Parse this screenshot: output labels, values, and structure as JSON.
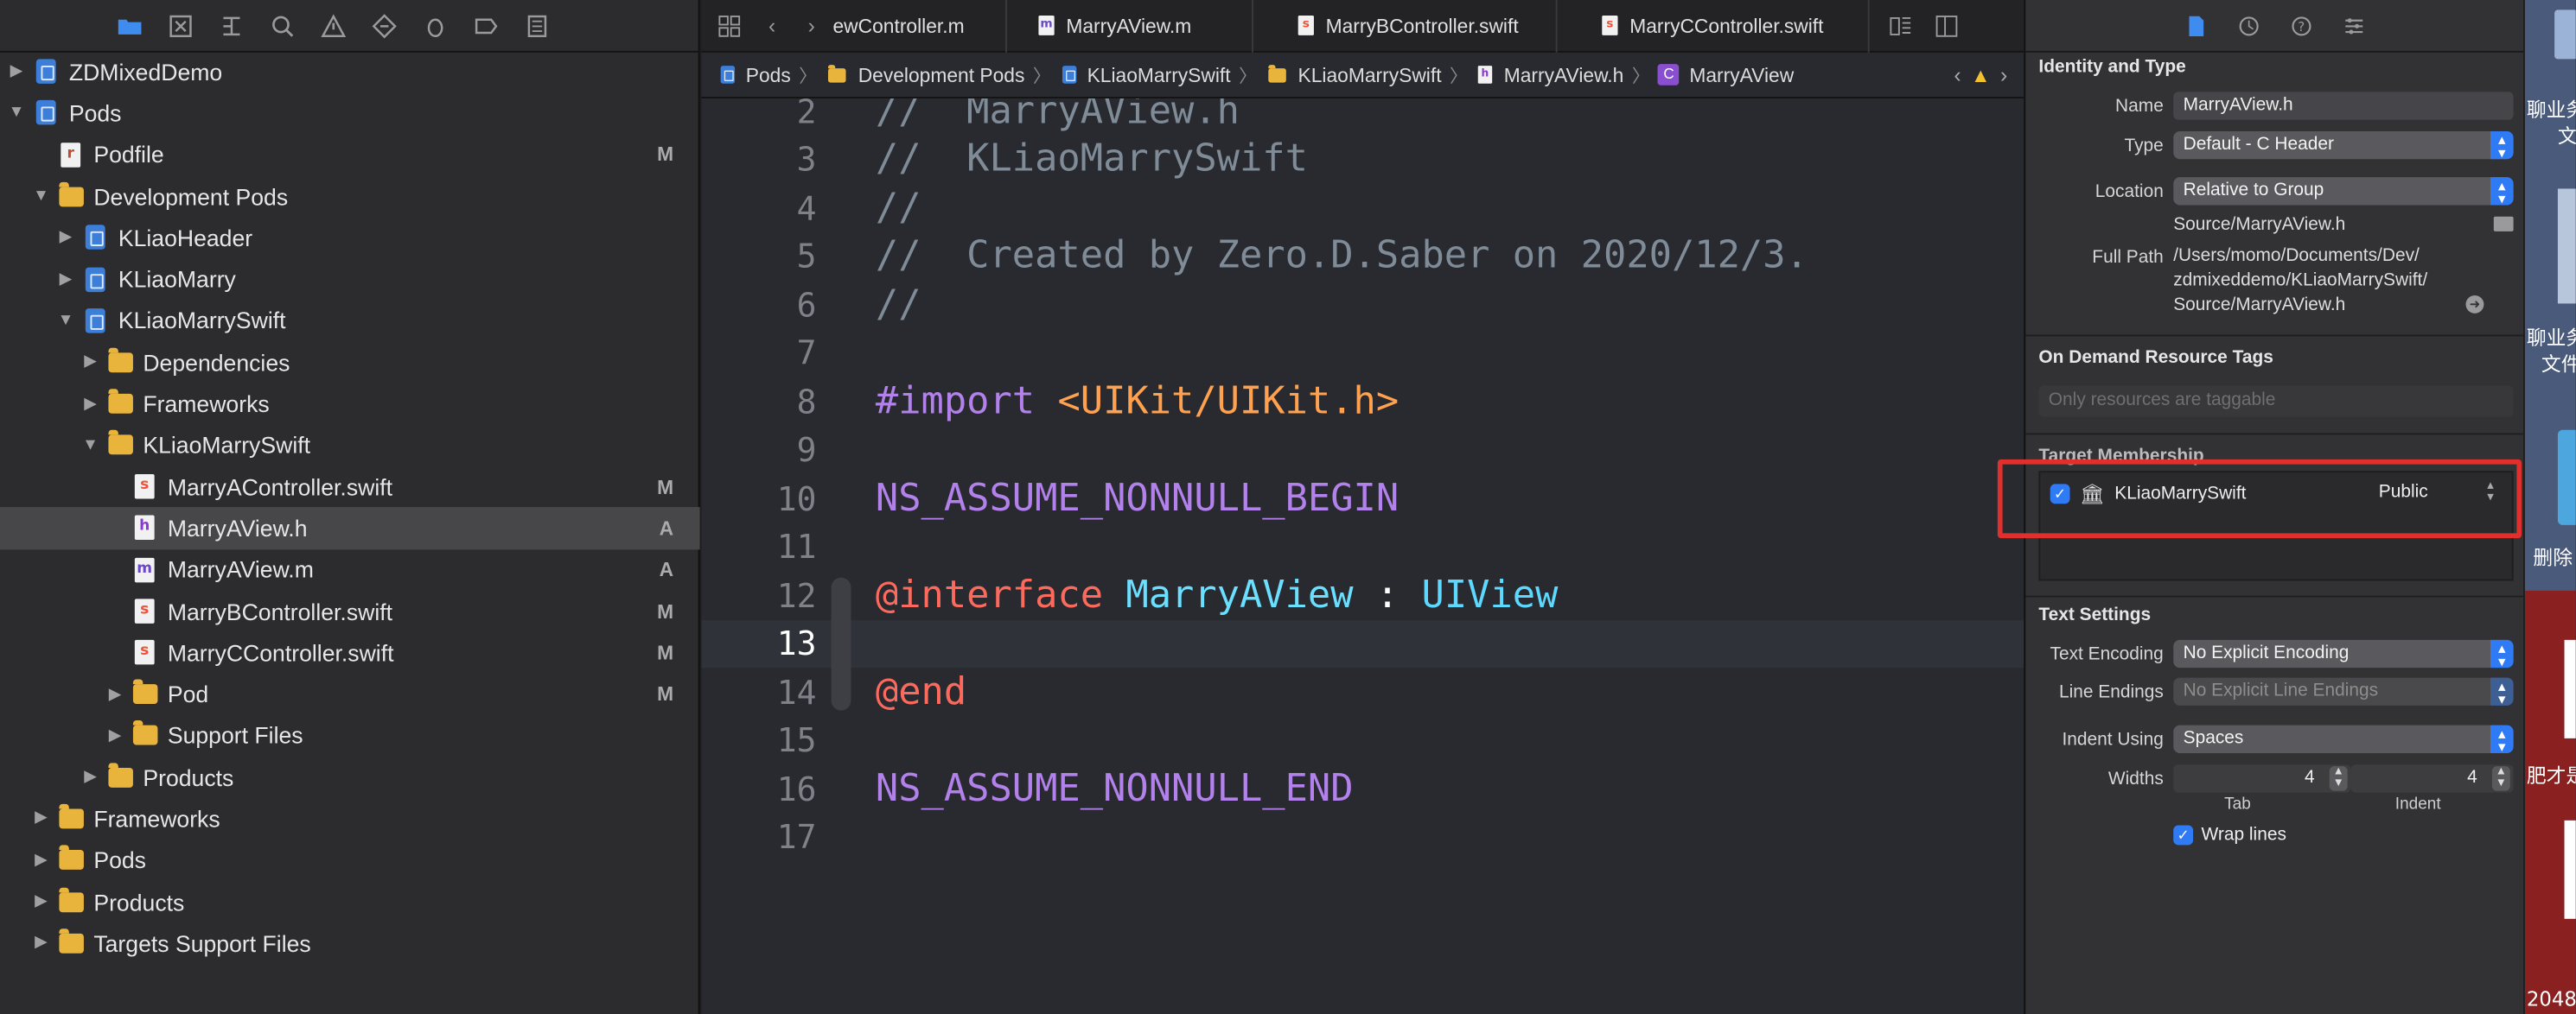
{
  "navigator": {
    "rows": [
      {
        "label": "ZDMixedDemo",
        "icon": "project-icon",
        "indent": 0,
        "tri": "▶",
        "status": ""
      },
      {
        "label": "Pods",
        "icon": "project-icon",
        "indent": 0,
        "tri": "▼",
        "status": ""
      },
      {
        "label": "Podfile",
        "icon": "podfile-icon",
        "indent": 1,
        "tri": "",
        "status": "M"
      },
      {
        "label": "Development Pods",
        "icon": "folder-icon",
        "indent": 1,
        "tri": "▼",
        "status": ""
      },
      {
        "label": "KLiaoHeader",
        "icon": "project-icon",
        "indent": 2,
        "tri": "▶",
        "status": ""
      },
      {
        "label": "KLiaoMarry",
        "icon": "project-icon",
        "indent": 2,
        "tri": "▶",
        "status": ""
      },
      {
        "label": "KLiaoMarrySwift",
        "icon": "project-icon",
        "indent": 2,
        "tri": "▼",
        "status": ""
      },
      {
        "label": "Dependencies",
        "icon": "folder-icon",
        "indent": 3,
        "tri": "▶",
        "status": ""
      },
      {
        "label": "Frameworks",
        "icon": "folder-icon",
        "indent": 3,
        "tri": "▶",
        "status": ""
      },
      {
        "label": "KLiaoMarrySwift",
        "icon": "folder-icon",
        "indent": 3,
        "tri": "▼",
        "status": ""
      },
      {
        "label": "MarryAController.swift",
        "icon": "swift-file-icon",
        "indent": 4,
        "tri": "",
        "status": "M"
      },
      {
        "label": "MarryAView.h",
        "icon": "header-file-icon",
        "indent": 4,
        "tri": "",
        "status": "A",
        "selected": true
      },
      {
        "label": "MarryAView.m",
        "icon": "objc-file-icon",
        "indent": 4,
        "tri": "",
        "status": "A"
      },
      {
        "label": "MarryBController.swift",
        "icon": "swift-file-icon",
        "indent": 4,
        "tri": "",
        "status": "M"
      },
      {
        "label": "MarryCController.swift",
        "icon": "swift-file-icon",
        "indent": 4,
        "tri": "",
        "status": "M"
      },
      {
        "label": "Pod",
        "icon": "folder-icon",
        "indent": 4,
        "tri": "▶",
        "status": "M"
      },
      {
        "label": "Support Files",
        "icon": "folder-icon",
        "indent": 4,
        "tri": "▶",
        "status": ""
      },
      {
        "label": "Products",
        "icon": "folder-icon",
        "indent": 3,
        "tri": "▶",
        "status": ""
      },
      {
        "label": "Frameworks",
        "icon": "folder-icon",
        "indent": 1,
        "tri": "▶",
        "status": ""
      },
      {
        "label": "Pods",
        "icon": "folder-icon",
        "indent": 1,
        "tri": "▶",
        "status": ""
      },
      {
        "label": "Products",
        "icon": "folder-icon",
        "indent": 1,
        "tri": "▶",
        "status": ""
      },
      {
        "label": "Targets Support Files",
        "icon": "folder-icon",
        "indent": 1,
        "tri": "▶",
        "status": ""
      }
    ]
  },
  "editor": {
    "tabs": [
      "ewController.m",
      "MarryAView.m",
      "MarryBController.swift",
      "MarryCController.swift"
    ],
    "breadcrumb": [
      "Pods",
      "Development Pods",
      "KLiaoMarrySwift",
      "KLiaoMarrySwift",
      "MarryAView.h",
      "MarryAView"
    ],
    "lines": [
      {
        "n": "2",
        "parts": [
          [
            "cmt",
            "//  MarryAView.h"
          ]
        ]
      },
      {
        "n": "3",
        "parts": [
          [
            "cmt",
            "//  KLiaoMarrySwift"
          ]
        ]
      },
      {
        "n": "4",
        "parts": [
          [
            "cmt",
            "//"
          ]
        ]
      },
      {
        "n": "5",
        "parts": [
          [
            "cmt",
            "//  Created by Zero.D.Saber on 2020/12/3."
          ]
        ]
      },
      {
        "n": "6",
        "parts": [
          [
            "cmt",
            "//"
          ]
        ]
      },
      {
        "n": "7",
        "parts": []
      },
      {
        "n": "8",
        "parts": [
          [
            "kw",
            "#import "
          ],
          [
            "str",
            "<UIKit/UIKit.h>"
          ]
        ]
      },
      {
        "n": "9",
        "parts": []
      },
      {
        "n": "10",
        "parts": [
          [
            "mac",
            "NS_ASSUME_NONNULL_BEGIN"
          ]
        ]
      },
      {
        "n": "11",
        "parts": []
      },
      {
        "n": "12",
        "parts": [
          [
            "at",
            "@interface "
          ],
          [
            "cls",
            "MarryAView"
          ],
          [
            "pl",
            " : "
          ],
          [
            "ty",
            "UIView"
          ]
        ]
      },
      {
        "n": "13",
        "parts": [],
        "current": true
      },
      {
        "n": "14",
        "parts": [
          [
            "at",
            "@end"
          ]
        ]
      },
      {
        "n": "15",
        "parts": []
      },
      {
        "n": "16",
        "parts": [
          [
            "mac",
            "NS_ASSUME_NONNULL_END"
          ]
        ]
      },
      {
        "n": "17",
        "parts": []
      }
    ]
  },
  "inspector": {
    "identity_header": "Identity and Type",
    "name_label": "Name",
    "name_value": "MarryAView.h",
    "type_label": "Type",
    "type_value": "Default - C Header",
    "location_label": "Location",
    "location_value": "Relative to Group",
    "location_path": "Source/MarryAView.h",
    "fullpath_label": "Full Path",
    "fullpath_lines": [
      "/Users/momo/Documents/Dev/",
      "zdmixeddemo/KLiaoMarrySwift/",
      "Source/MarryAView.h"
    ],
    "odr_header": "On Demand Resource Tags",
    "odr_placeholder": "Only resources are taggable",
    "target_header": "Target Membership",
    "target_name": "KLiaoMarrySwift",
    "target_visibility": "Public",
    "text_header": "Text Settings",
    "encoding_label": "Text Encoding",
    "encoding_value": "No Explicit Encoding",
    "endings_label": "Line Endings",
    "endings_value": "No Explicit Line Endings",
    "indent_label": "Indent Using",
    "indent_value": "Spaces",
    "widths_label": "Widths",
    "tab_width": "4",
    "indent_width": "4",
    "tab_sub": "Tab",
    "indent_sub": "Indent",
    "wrap_label": "Wrap lines"
  },
  "desktop": {
    "labels": [
      "聊业务",
      "文",
      "聊业务",
      "文件",
      "删除",
      "肥才是",
      "2048"
    ]
  },
  "colors": {
    "accent": "#2f7bf6",
    "highlight_box": "#e0302e",
    "selection": "#474749"
  }
}
